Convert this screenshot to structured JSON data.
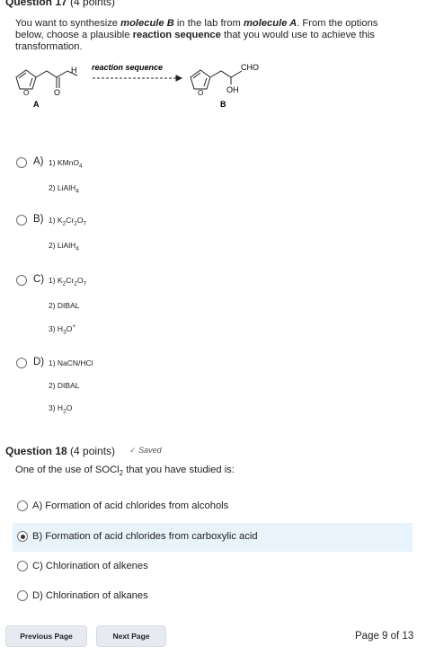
{
  "q17": {
    "label": "Question 17",
    "points": "(4 points)",
    "prompt_parts": [
      "You want to synthesize ",
      "molecule B",
      " in the lab from ",
      "molecule A",
      ". From the options below, choose a plausible ",
      "reaction sequence",
      " that you would use to achieve this transformation."
    ],
    "scheme": {
      "arrow_label": "reaction sequence",
      "mol_a_label": "A",
      "mol_b_label": "B",
      "mol_a_h": "H",
      "mol_a_o": "O",
      "mol_b_cho": "CHO",
      "mol_b_oh": "OH",
      "ring_o": "O"
    },
    "options": [
      {
        "letter": "A)",
        "steps": [
          [
            "1) KMnO",
            "4",
            ""
          ],
          [
            "2) LiAlH",
            "4",
            ""
          ]
        ]
      },
      {
        "letter": "B)",
        "steps": [
          [
            "1) K",
            "2",
            "Cr",
            "2",
            "O",
            "7"
          ],
          [
            "2) LiAlH",
            "4",
            ""
          ]
        ]
      },
      {
        "letter": "C)",
        "steps": [
          [
            "1) K",
            "2",
            "Cr",
            "2",
            "O",
            "7"
          ],
          [
            "2) DIBAL"
          ],
          [
            "3) H",
            "3",
            "O",
            "+"
          ]
        ]
      },
      {
        "letter": "D)",
        "steps": [
          [
            "1) NaCN/HCl"
          ],
          [
            "2) DIBAL"
          ],
          [
            "3) H",
            "2",
            "O"
          ]
        ]
      }
    ]
  },
  "q18": {
    "label": "Question 18",
    "points": "(4 points)",
    "saved": "Saved",
    "saved_icon": "check-icon",
    "prompt_pre": "One of the use of SOCl",
    "prompt_sub": "2",
    "prompt_post": " that you have studied is:",
    "options": [
      {
        "text": "A) Formation of acid chlorides from alcohols",
        "selected": false
      },
      {
        "text": "B) Formation of acid chlorides from carboxylic acid",
        "selected": true
      },
      {
        "text": "C) Chlorination of alkenes",
        "selected": false
      },
      {
        "text": "D) Chlorination of alkanes",
        "selected": false
      }
    ]
  },
  "nav": {
    "prev_label": "Previous Page",
    "next_label": "Next Page",
    "page_indicator": "Page 9 of 13"
  },
  "colors": {
    "selected_bg": "#e9f3fc",
    "button_bg": "#e7ebf1"
  }
}
